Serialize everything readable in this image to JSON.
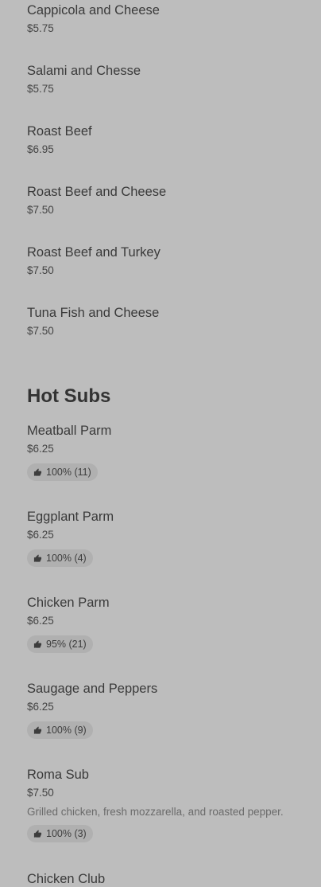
{
  "cold_items": [
    {
      "name": "Cappicola and Cheese",
      "price": "$5.75"
    },
    {
      "name": "Salami and Chesse",
      "price": "$5.75"
    },
    {
      "name": "Roast Beef",
      "price": "$6.95"
    },
    {
      "name": "Roast Beef and Cheese",
      "price": "$7.50"
    },
    {
      "name": "Roast Beef and Turkey",
      "price": "$7.50"
    },
    {
      "name": "Tuna Fish and Cheese",
      "price": "$7.50"
    }
  ],
  "hot_subs": {
    "title": "Hot Subs",
    "items": [
      {
        "name": "Meatball Parm",
        "price": "$6.25",
        "rating": "100% (11)"
      },
      {
        "name": "Eggplant Parm",
        "price": "$6.25",
        "rating": "100% (4)"
      },
      {
        "name": "Chicken Parm",
        "price": "$6.25",
        "rating": "95% (21)"
      },
      {
        "name": "Saugage and Peppers",
        "price": "$6.25",
        "rating": "100% (9)"
      },
      {
        "name": "Roma Sub",
        "price": "$7.50",
        "description": "Grilled chicken, fresh mozzarella, and roasted pepper.",
        "rating": "100% (3)"
      },
      {
        "name": "Chicken Club"
      }
    ]
  },
  "icons": {
    "rating": "thumbs-up-icon"
  },
  "colors": {
    "background": "#bdbdbd",
    "badge": "#b0b0b0",
    "text": "#333333",
    "muted": "#6b6b6b"
  }
}
